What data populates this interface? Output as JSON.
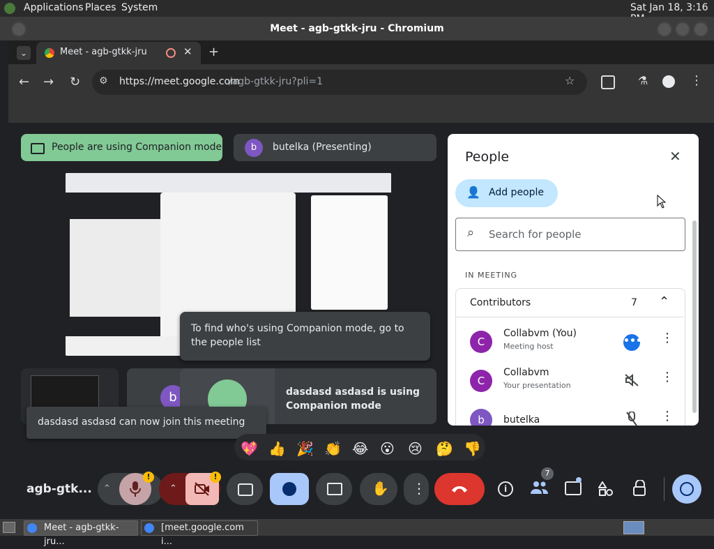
{
  "os": {
    "menu": [
      "Applications",
      "Places",
      "System"
    ],
    "clock": "Sat Jan 18,  3:16 PM"
  },
  "window": {
    "title": "Meet - agb-gtkk-jru - Chromium"
  },
  "browser": {
    "tab_title": "Meet - agb-gtkk-jru",
    "url_host": "https://meet.google.com",
    "url_path": "/agb-gtkk-jru?pli=1"
  },
  "meet": {
    "companion_banner": "People are using Companion mode",
    "presenter_avatar": "b",
    "presenter_label": "butelka (Presenting)",
    "tooltip": "To find who's using Companion mode, go to the people list",
    "companion_tile_text": "dasdasd asdasd is using Companion mode",
    "small_tile_avatar": "b",
    "join_toast": "dasdasd asdasd can now join this meeting",
    "meeting_code": "agb-gtk...",
    "reactions": [
      "💖",
      "👍",
      "🎉",
      "👏",
      "😂",
      "😮",
      "😢",
      "🤔",
      "👎"
    ],
    "people_badge": "7",
    "mic_alert": "!",
    "cam_alert": "!"
  },
  "people_panel": {
    "title": "People",
    "add_people": "Add people",
    "search_placeholder": "Search for people",
    "section": "IN MEETING",
    "group_label": "Contributors",
    "group_count": "7",
    "participants": [
      {
        "initial": "C",
        "name": "Collabvm (You)",
        "role": "Meeting host"
      },
      {
        "initial": "C",
        "name": "Collabvm",
        "role": "Your presentation"
      },
      {
        "initial": "b",
        "name": "butelka",
        "role": ""
      }
    ]
  },
  "taskbar": {
    "items": [
      "Meet - agb-gtkk-jru...",
      "[meet.google.com i..."
    ]
  }
}
